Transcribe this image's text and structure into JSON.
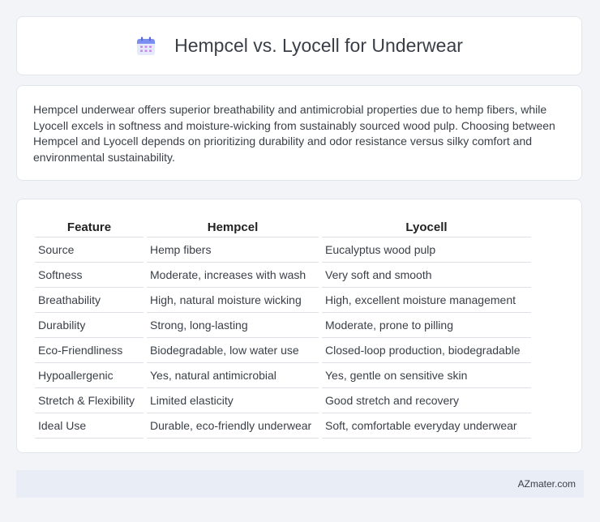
{
  "header": {
    "title": "Hempcel vs. Lyocell for Underwear",
    "icon": "calendar-icon"
  },
  "intro": {
    "text": "Hempcel underwear offers superior breathability and antimicrobial properties due to hemp fibers, while Lyocell excels in softness and moisture-wicking from sustainably sourced wood pulp. Choosing between Hempcel and Lyocell depends on prioritizing durability and odor resistance versus silky comfort and environmental sustainability."
  },
  "table": {
    "headers": [
      "Feature",
      "Hempcel",
      "Lyocell"
    ],
    "rows": [
      [
        "Source",
        "Hemp fibers",
        "Eucalyptus wood pulp"
      ],
      [
        "Softness",
        "Moderate, increases with wash",
        "Very soft and smooth"
      ],
      [
        "Breathability",
        "High, natural moisture wicking",
        "High, excellent moisture management"
      ],
      [
        "Durability",
        "Strong, long-lasting",
        "Moderate, prone to pilling"
      ],
      [
        "Eco-Friendliness",
        "Biodegradable, low water use",
        "Closed-loop production, biodegradable"
      ],
      [
        "Hypoallergenic",
        "Yes, natural antimicrobial",
        "Yes, gentle on sensitive skin"
      ],
      [
        "Stretch & Flexibility",
        "Limited elasticity",
        "Good stretch and recovery"
      ],
      [
        "Ideal Use",
        "Durable, eco-friendly underwear",
        "Soft, comfortable everyday underwear"
      ]
    ]
  },
  "footer": {
    "site": "AZmater.com"
  },
  "colors": {
    "background": "#f2f4f8",
    "card": "#ffffff",
    "footer": "#e8edf6",
    "icon_accent": "#7b8ff0"
  }
}
